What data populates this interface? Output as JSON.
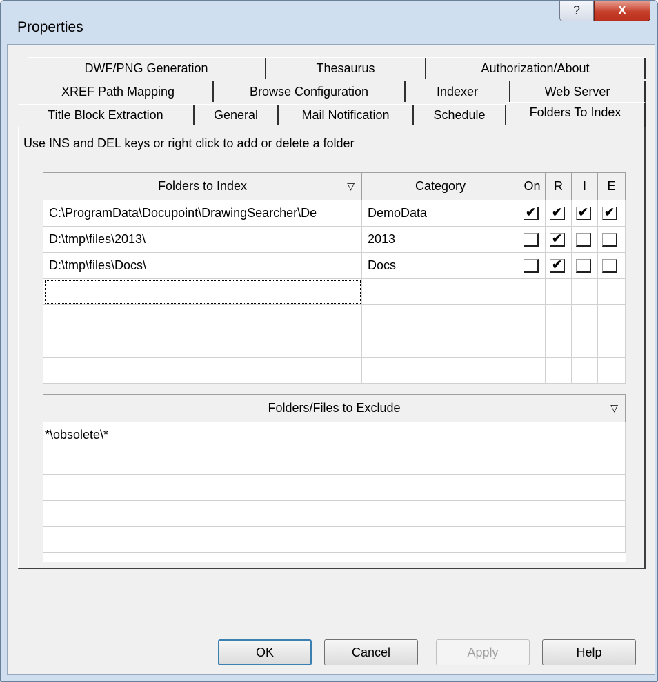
{
  "window": {
    "title": "Properties",
    "help_glyph": "?",
    "close_glyph": "X"
  },
  "tabs": {
    "row1": [
      "DWF/PNG Generation",
      "Thesaurus",
      "Authorization/About"
    ],
    "row2": [
      "XREF Path Mapping",
      "Browse Configuration",
      "Indexer",
      "Web Server"
    ],
    "row3": [
      "Title Block Extraction",
      "General",
      "Mail Notification",
      "Schedule",
      "Folders To Index"
    ],
    "active": "Folders To Index"
  },
  "hint": "Use INS and DEL keys or right click to add or delete a folder",
  "folders_table": {
    "columns": {
      "folder": "Folders to Index",
      "category": "Category",
      "on": "On",
      "r": "R",
      "i": "I",
      "e": "E"
    },
    "rows": [
      {
        "folder": "C:\\ProgramData\\Docupoint\\DrawingSearcher\\De",
        "category": "DemoData",
        "on": true,
        "r": true,
        "i": true,
        "e": true
      },
      {
        "folder": "D:\\tmp\\files\\2013\\",
        "category": "2013",
        "on": false,
        "r": true,
        "i": false,
        "e": false
      },
      {
        "folder": "D:\\tmp\\files\\Docs\\",
        "category": "Docs",
        "on": false,
        "r": true,
        "i": false,
        "e": false
      }
    ]
  },
  "exclude_table": {
    "header": "Folders/Files to Exclude",
    "rows": [
      "*\\obsolete\\*"
    ]
  },
  "buttons": {
    "ok": "OK",
    "cancel": "Cancel",
    "apply": "Apply",
    "help": "Help"
  },
  "glyphs": {
    "check": "✔",
    "sort": "▽"
  }
}
